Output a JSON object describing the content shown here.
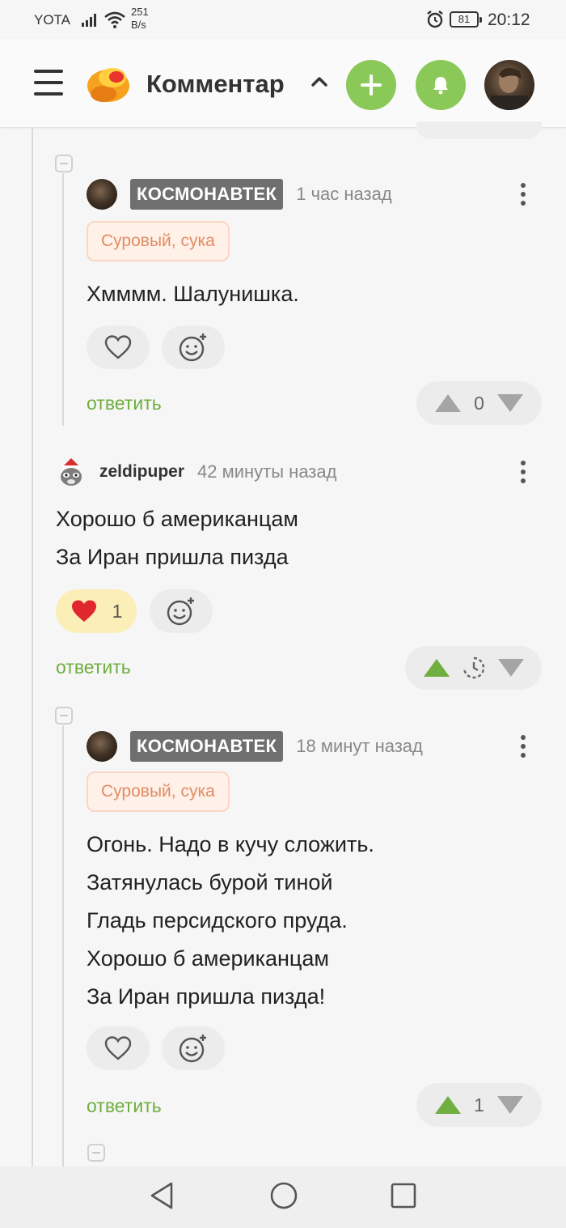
{
  "status_bar": {
    "carrier": "YOTA",
    "net_speed_value": "251",
    "net_speed_unit": "B/s",
    "battery": "81",
    "time": "20:12"
  },
  "header": {
    "title": "Комментар",
    "icons": [
      "menu-icon",
      "pikabu-logo",
      "chevron-up-icon",
      "plus-icon",
      "bell-icon",
      "user-avatar"
    ],
    "accent_color": "#8ac858"
  },
  "comments": [
    {
      "username": "КОСМОНАВТЕК",
      "time": "1 час назад",
      "tag": "Суровый, сука",
      "lines": [
        "Хмммм. Шалунишка."
      ],
      "reply_label": "ответить",
      "rating": "0"
    },
    {
      "username": "zeldipuper",
      "time": "42 минуты назад",
      "lines": [
        "Хорошо б американцам",
        "За Иран пришла пизда"
      ],
      "likes": "1",
      "reply_label": "ответить"
    },
    {
      "username": "КОСМОНАВТЕК",
      "time": "18 минут назад",
      "tag": "Суровый, сука",
      "lines": [
        "Огонь. Надо в кучу сложить.",
        "Затянулась бурой тиной",
        "Гладь персидского пруда.",
        "Хорошо б американцам",
        "За Иран пришла пизда!"
      ],
      "reply_label": "ответить",
      "rating": "1"
    }
  ],
  "colors": {
    "reply": "#6fae3f",
    "tag_text": "#e08d64",
    "upvote_active": "#6fae3f",
    "heart_active": "#e0262e"
  }
}
